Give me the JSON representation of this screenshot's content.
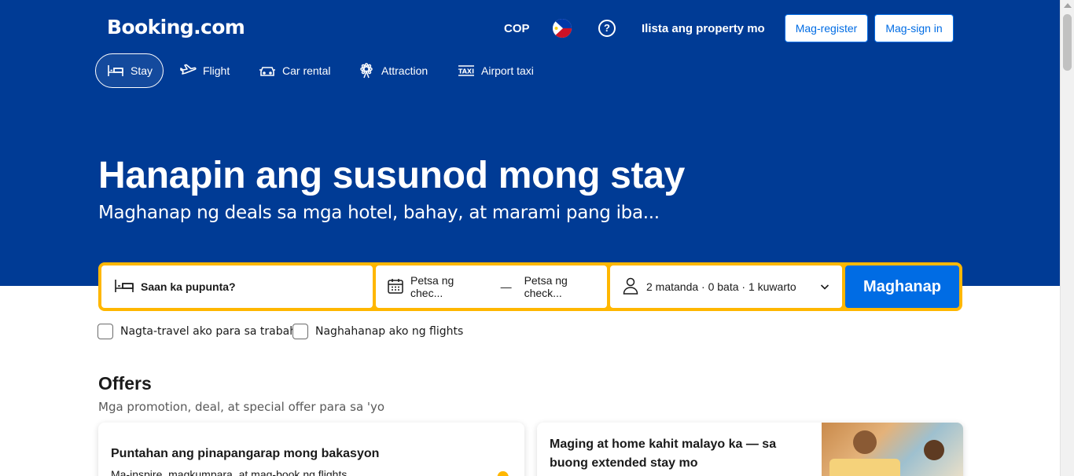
{
  "header": {
    "logo": "Booking.com",
    "currency": "COP",
    "flag_icon": "philippines-flag-icon",
    "help_icon": "question-circle-icon",
    "list_property": "Ilista ang property mo",
    "register_label": "Mag-register",
    "signin_label": "Mag-sign in"
  },
  "nav": {
    "tabs": [
      {
        "label": "Stay",
        "icon": "bed-icon",
        "active": true
      },
      {
        "label": "Flight",
        "icon": "plane-icon",
        "active": false
      },
      {
        "label": "Car rental",
        "icon": "car-icon",
        "active": false
      },
      {
        "label": "Attraction",
        "icon": "attraction-icon",
        "active": false
      },
      {
        "label": "Airport taxi",
        "icon": "taxi-icon",
        "active": false
      }
    ]
  },
  "hero": {
    "title": "Hanapin ang susunod mong stay",
    "subtitle": "Maghanap ng deals sa mga hotel, bahay, at marami pang iba..."
  },
  "search": {
    "destination_placeholder": "Saan ka pupunta?",
    "checkin_placeholder": "Petsa ng chec...",
    "date_separator": "—",
    "checkout_placeholder": "Petsa ng check...",
    "guests": "2 matanda · 0 bata · 1 kuwarto",
    "search_button": "Maghanap"
  },
  "options": {
    "work_travel": "Nagta-travel ako para sa trabaho",
    "flights": "Naghahanap ako ng flights"
  },
  "offers": {
    "title": "Offers",
    "subtitle": "Mga promotion, deal, at special offer para sa 'yo",
    "cards": [
      {
        "title": "Puntahan ang pinapangarap mong bakasyon",
        "desc": "Ma-inspire, magkumpara, at mag-book ng flights"
      },
      {
        "title": "Maging at home kahit malayo ka — sa buong extended stay mo"
      }
    ]
  },
  "colors": {
    "brand_blue": "#003b95",
    "accent_yellow": "#ffb700",
    "button_blue": "#006ce4"
  }
}
